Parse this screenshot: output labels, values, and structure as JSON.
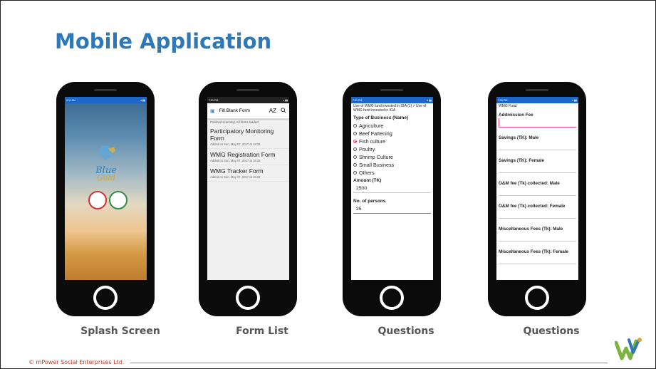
{
  "slide": {
    "title": "Mobile Application",
    "footer": "© mPower Social Enterprises Ltd.",
    "accent_color": "#2e78b8"
  },
  "captions": [
    "Splash Screen",
    "Form List",
    "Questions",
    "Questions"
  ],
  "splash": {
    "status_time": "9:11 AM",
    "logo_line1": "Blue",
    "logo_line2": "Gold"
  },
  "form_list": {
    "status_time": "7:51 PM",
    "toolbar_title": "Fill Blank Form",
    "sort_icon": "AZ",
    "search_icon": "search-icon",
    "note": "Finished scanning. All forms loaded.",
    "forms": [
      {
        "name": "Participatory Monitoring Form",
        "added": "Added on Sun, May 07, 2017 at 18:32"
      },
      {
        "name": "WMG Registration Form",
        "added": "Added on Sun, May 07, 2017 at 18:32"
      },
      {
        "name": "WMG Tracker Form",
        "added": "Added on Sun, May 07, 2017 at 18:32"
      }
    ]
  },
  "questions1": {
    "status_time": "7:51 PM",
    "header": "Use of WMG fund invested in IGA (1) > Use of WMG fund invested in IGA",
    "type_label": "Type of Business (Name)",
    "options": [
      "Agriculture",
      "Beef Fattening",
      "Fish culture",
      "Poultry",
      "Shrimp Culture",
      "Small Business",
      "Others"
    ],
    "selected_option": "Fish culture",
    "amount_label": "Amount (TK)",
    "amount_value": "2500",
    "persons_label": "No. of persons",
    "persons_value": "25"
  },
  "questions2": {
    "status_time": "7:51 PM",
    "header": "WMG Fund",
    "fields": [
      "Addmission Fee",
      "Savings (TK): Male",
      "Savings (TK): Female",
      "O&M fee (Tk) collected: Male",
      "O&M fee (Tk) collected: Female",
      "Miscellaneous Fees (Tk): Male",
      "Miscellaneous Fees (Tk): Female"
    ]
  }
}
